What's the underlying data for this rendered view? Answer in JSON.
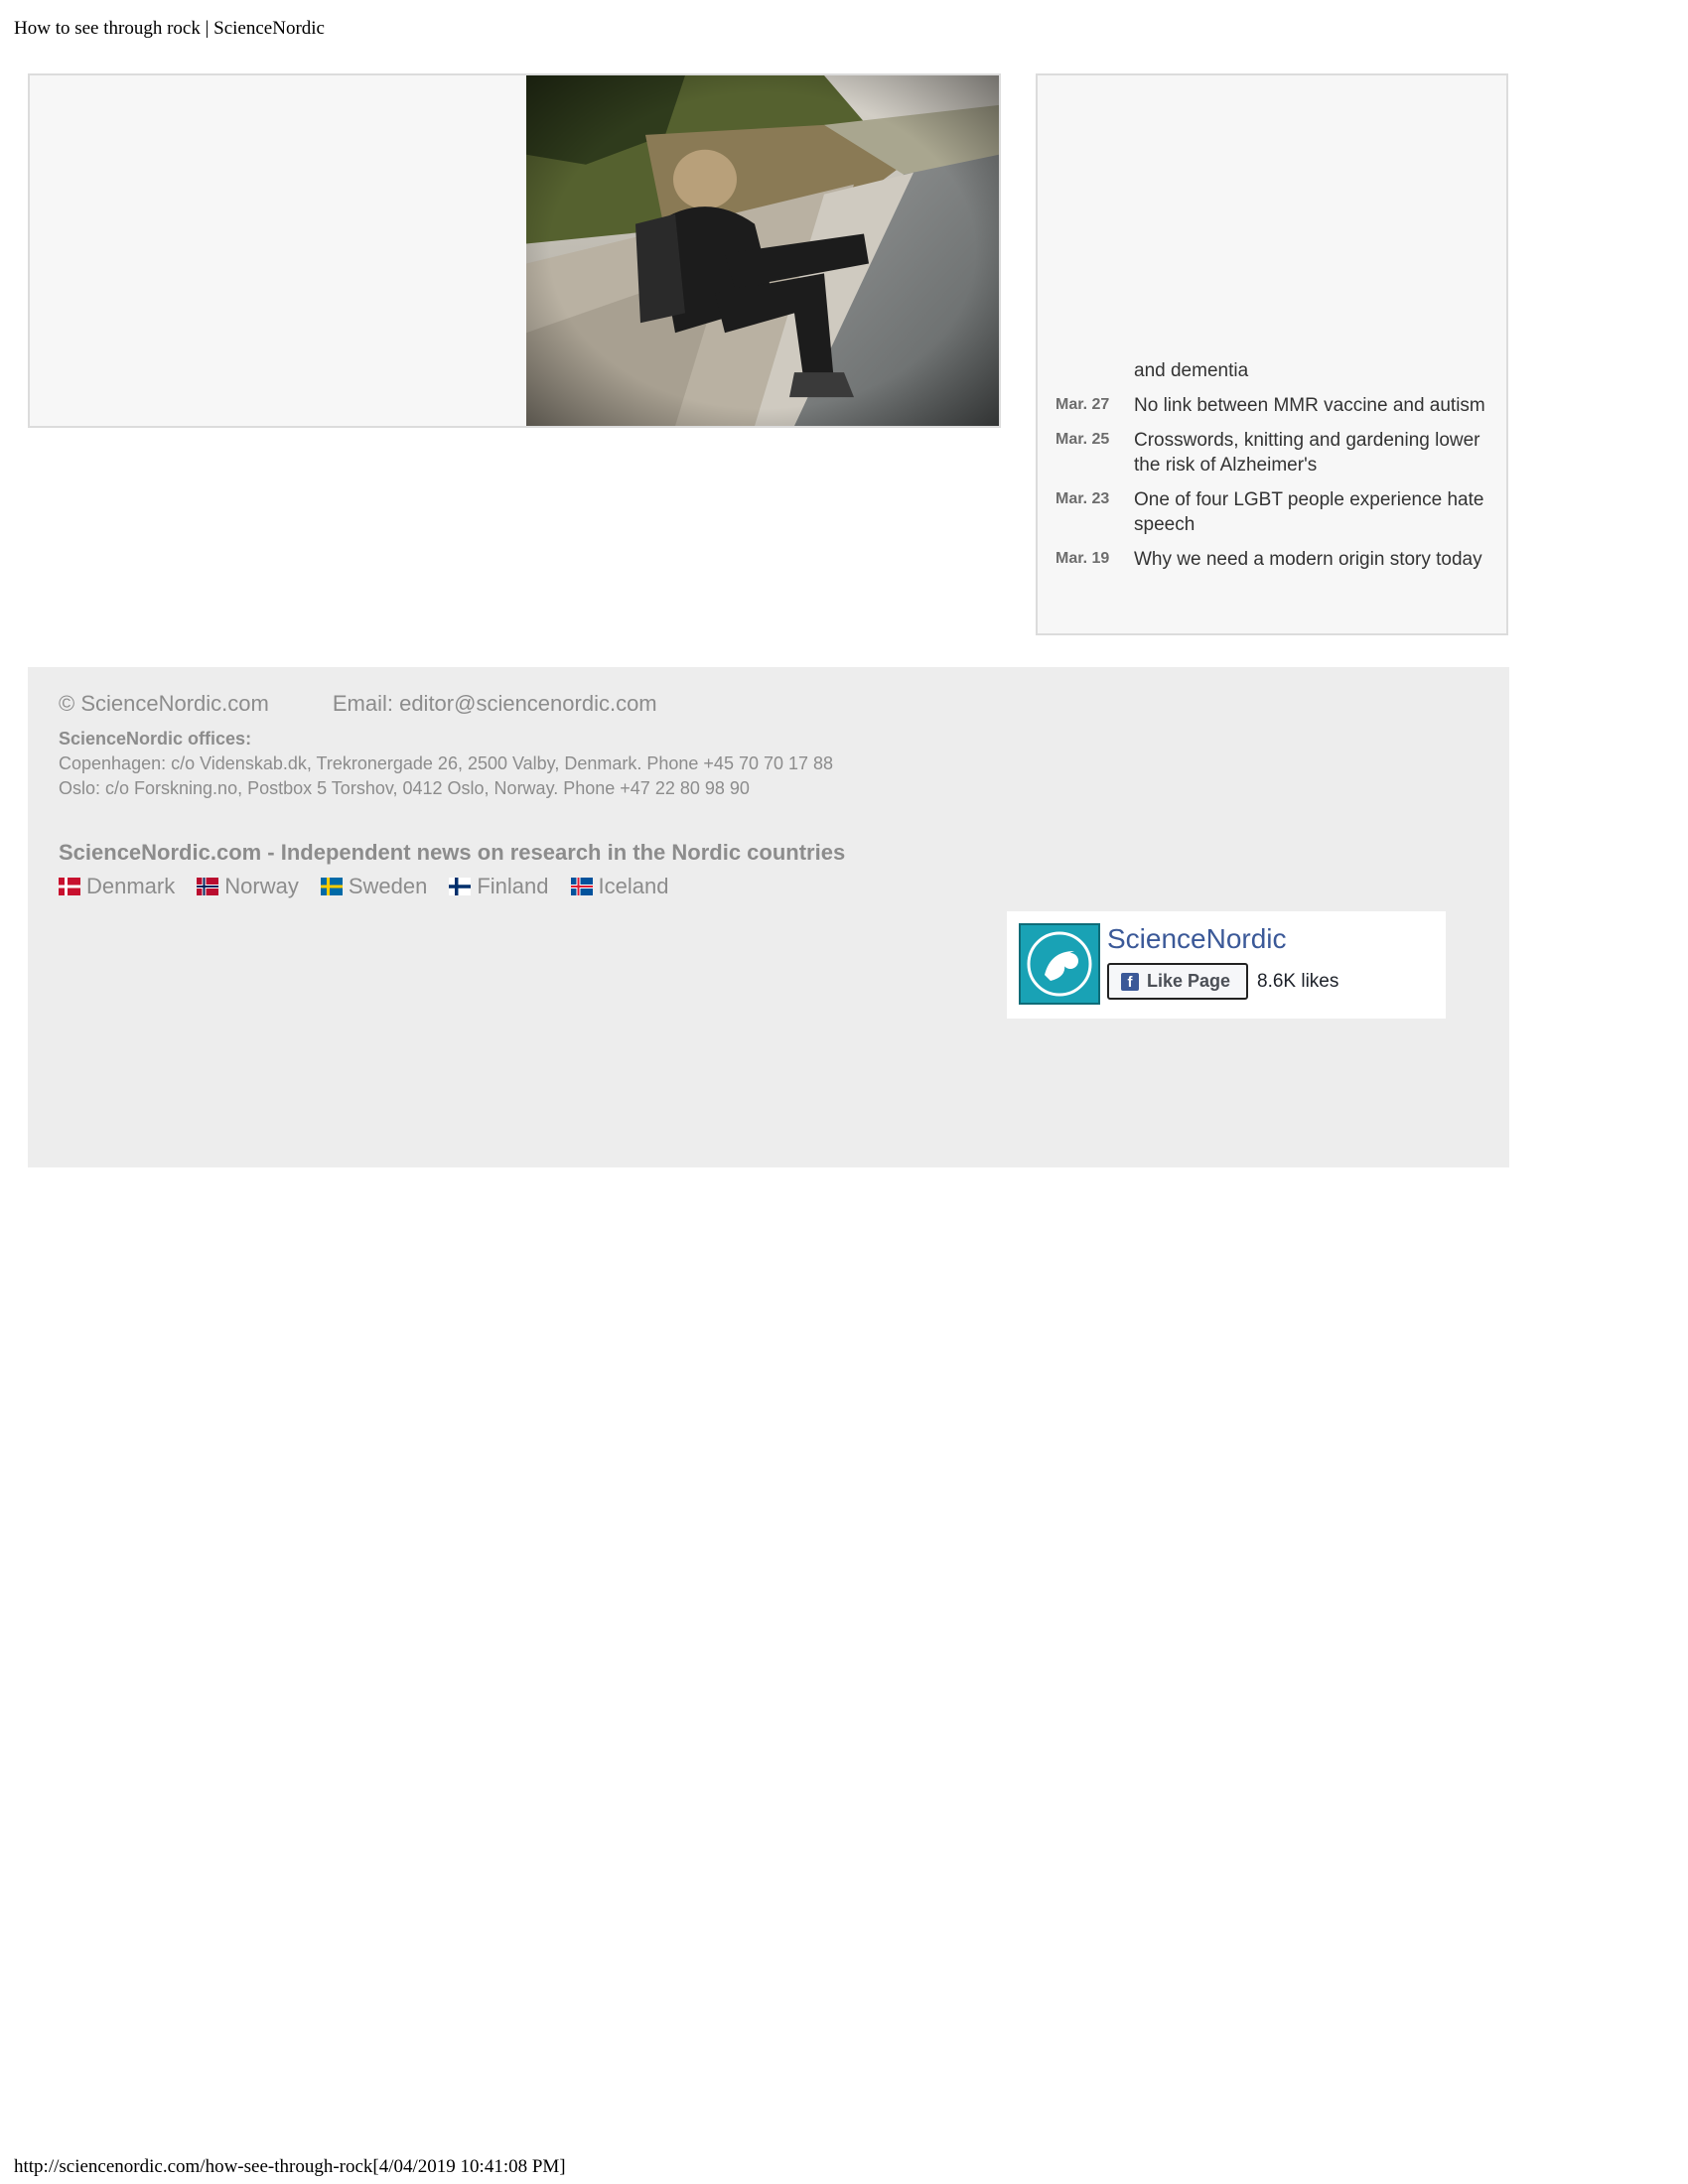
{
  "page": {
    "header_title": "How to see through rock | ScienceNordic",
    "footer_url": "http://sciencenordic.com/how-see-through-rock[4/04/2019 10:41:08 PM]"
  },
  "sidebar": {
    "news": [
      {
        "date": "",
        "title": "and dementia"
      },
      {
        "date": "Mar. 27",
        "title": "No link between MMR vaccine and autism"
      },
      {
        "date": "Mar. 25",
        "title": "Crosswords, knitting and gardening lower the risk of Alzheimer's"
      },
      {
        "date": "Mar. 23",
        "title": "One of four LGBT people experience hate speech"
      },
      {
        "date": "Mar. 19",
        "title": "Why we need a modern origin story today"
      }
    ]
  },
  "footer": {
    "copyright": "© ScienceNordic.com",
    "email": "Email: editor@sciencenordic.com",
    "offices_heading": "ScienceNordic offices:",
    "copenhagen": "Copenhagen: c/o Videnskab.dk, Trekronergade 26, 2500 Valby, Denmark. Phone +45 70 70 17 88",
    "oslo": "Oslo: c/o Forskning.no, Postbox 5 Torshov, 0412 Oslo, Norway. Phone +47 22 80 98 90",
    "tagline": "ScienceNordic.com - Independent news on research in the Nordic countries",
    "countries": [
      "Denmark",
      "Norway",
      "Sweden",
      "Finland",
      "Iceland"
    ]
  },
  "facebook": {
    "page_name": "ScienceNordic",
    "like_label": "Like Page",
    "likes": "8.6K likes",
    "accent": "#3b5998"
  },
  "colors": {
    "footer_bg": "#ededed",
    "card_bg": "#f7f7f7",
    "muted_text": "#8c8c8c"
  }
}
